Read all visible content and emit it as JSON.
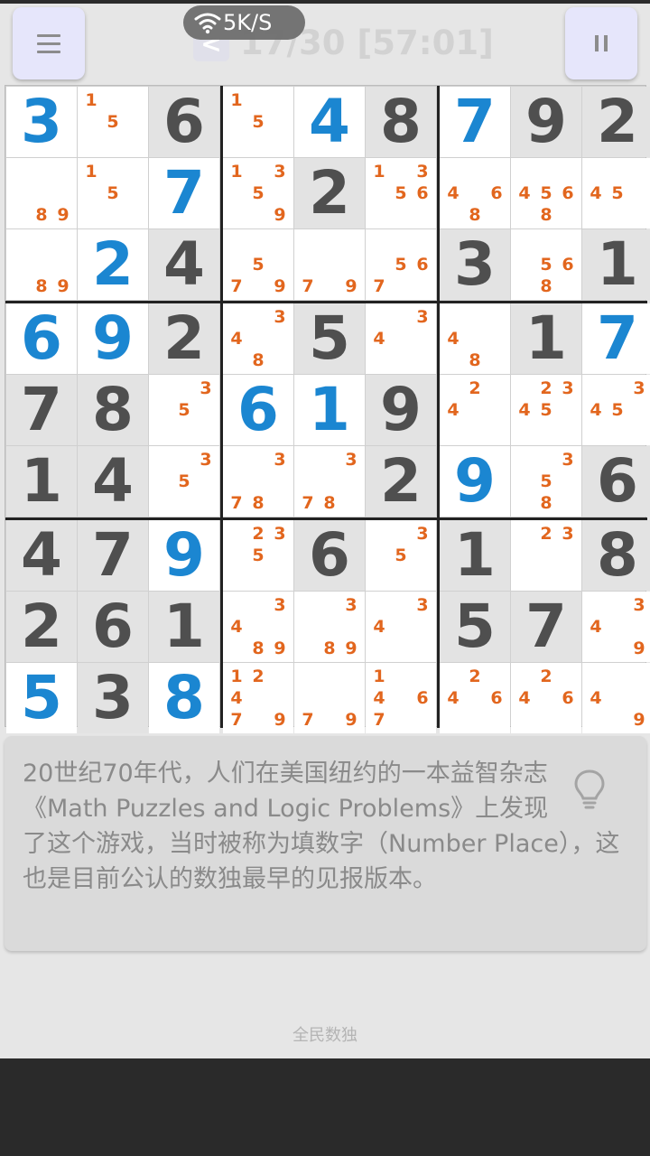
{
  "header": {
    "menu_icon": "menu-icon",
    "pause_icon": "pause-icon",
    "back_label": "<",
    "progress": "17/30 [57:01]",
    "net_speed": "5K/S",
    "wifi_icon": "wifi-icon"
  },
  "colors": {
    "given": "#4f4f4f",
    "filled": "#1b86d1",
    "note": "#e2661e",
    "given_bg": "#e3e3e3",
    "button_bg": "#e6e6fb"
  },
  "board": {
    "rows": [
      [
        {
          "v": "3",
          "t": "f"
        },
        {
          "n": [
            1,
            5
          ]
        },
        {
          "v": "6",
          "t": "g"
        },
        {
          "n": [
            1,
            5
          ]
        },
        {
          "v": "4",
          "t": "f"
        },
        {
          "v": "8",
          "t": "g"
        },
        {
          "v": "7",
          "t": "f"
        },
        {
          "v": "9",
          "t": "g"
        },
        {
          "v": "2",
          "t": "g"
        }
      ],
      [
        {
          "n": [
            8,
            9
          ]
        },
        {
          "n": [
            1,
            5
          ]
        },
        {
          "v": "7",
          "t": "f"
        },
        {
          "n": [
            1,
            3,
            5,
            9
          ]
        },
        {
          "v": "2",
          "t": "g"
        },
        {
          "n": [
            1,
            3,
            5,
            6
          ]
        },
        {
          "n": [
            4,
            6,
            8
          ]
        },
        {
          "n": [
            4,
            5,
            6,
            8
          ]
        },
        {
          "n": [
            4,
            5
          ]
        }
      ],
      [
        {
          "n": [
            8,
            9
          ]
        },
        {
          "v": "2",
          "t": "f"
        },
        {
          "v": "4",
          "t": "g"
        },
        {
          "n": [
            5,
            7,
            9
          ]
        },
        {
          "n": [
            7,
            9
          ]
        },
        {
          "n": [
            5,
            6,
            7
          ]
        },
        {
          "v": "3",
          "t": "g"
        },
        {
          "n": [
            5,
            6,
            8
          ]
        },
        {
          "v": "1",
          "t": "g"
        }
      ],
      [
        {
          "v": "6",
          "t": "f"
        },
        {
          "v": "9",
          "t": "f"
        },
        {
          "v": "2",
          "t": "g"
        },
        {
          "n": [
            3,
            4,
            8
          ]
        },
        {
          "v": "5",
          "t": "g"
        },
        {
          "n": [
            3,
            4
          ]
        },
        {
          "n": [
            4,
            8
          ]
        },
        {
          "v": "1",
          "t": "g"
        },
        {
          "v": "7",
          "t": "f"
        }
      ],
      [
        {
          "v": "7",
          "t": "g"
        },
        {
          "v": "8",
          "t": "g"
        },
        {
          "n": [
            3,
            5
          ]
        },
        {
          "v": "6",
          "t": "f"
        },
        {
          "v": "1",
          "t": "f"
        },
        {
          "v": "9",
          "t": "g"
        },
        {
          "n": [
            2,
            4
          ]
        },
        {
          "n": [
            2,
            3,
            4,
            5
          ]
        },
        {
          "n": [
            3,
            4,
            5
          ]
        }
      ],
      [
        {
          "v": "1",
          "t": "g"
        },
        {
          "v": "4",
          "t": "g"
        },
        {
          "n": [
            3,
            5
          ]
        },
        {
          "n": [
            3,
            7,
            8
          ]
        },
        {
          "n": [
            3,
            7,
            8
          ]
        },
        {
          "v": "2",
          "t": "g"
        },
        {
          "v": "9",
          "t": "f"
        },
        {
          "n": [
            3,
            5,
            8
          ]
        },
        {
          "v": "6",
          "t": "g"
        }
      ],
      [
        {
          "v": "4",
          "t": "g"
        },
        {
          "v": "7",
          "t": "g"
        },
        {
          "v": "9",
          "t": "f"
        },
        {
          "n": [
            2,
            3,
            5
          ]
        },
        {
          "v": "6",
          "t": "g"
        },
        {
          "n": [
            3,
            5
          ]
        },
        {
          "v": "1",
          "t": "g"
        },
        {
          "n": [
            2,
            3
          ]
        },
        {
          "v": "8",
          "t": "g"
        }
      ],
      [
        {
          "v": "2",
          "t": "g"
        },
        {
          "v": "6",
          "t": "g"
        },
        {
          "v": "1",
          "t": "g"
        },
        {
          "n": [
            3,
            4,
            8,
            9
          ]
        },
        {
          "n": [
            3,
            8,
            9
          ]
        },
        {
          "n": [
            3,
            4
          ]
        },
        {
          "v": "5",
          "t": "g"
        },
        {
          "v": "7",
          "t": "g"
        },
        {
          "n": [
            3,
            4,
            9
          ]
        }
      ],
      [
        {
          "v": "5",
          "t": "f"
        },
        {
          "v": "3",
          "t": "g"
        },
        {
          "v": "8",
          "t": "f"
        },
        {
          "n": [
            1,
            2,
            4,
            7,
            9
          ]
        },
        {
          "n": [
            7,
            9
          ]
        },
        {
          "n": [
            1,
            4,
            6,
            7
          ]
        },
        {
          "n": [
            2,
            4,
            6
          ]
        },
        {
          "n": [
            2,
            4,
            6
          ]
        },
        {
          "n": [
            4,
            9
          ]
        }
      ]
    ]
  },
  "tip": {
    "text": "20世纪70年代，人们在美国纽约的一本益智杂志《Math Puzzles and Logic Problems》上发现了这个游戏，当时被称为填数字（Number Place），这也是目前公认的数独最早的见报版本。",
    "icon": "lightbulb-icon"
  },
  "footer": {
    "label": "全民数独"
  }
}
